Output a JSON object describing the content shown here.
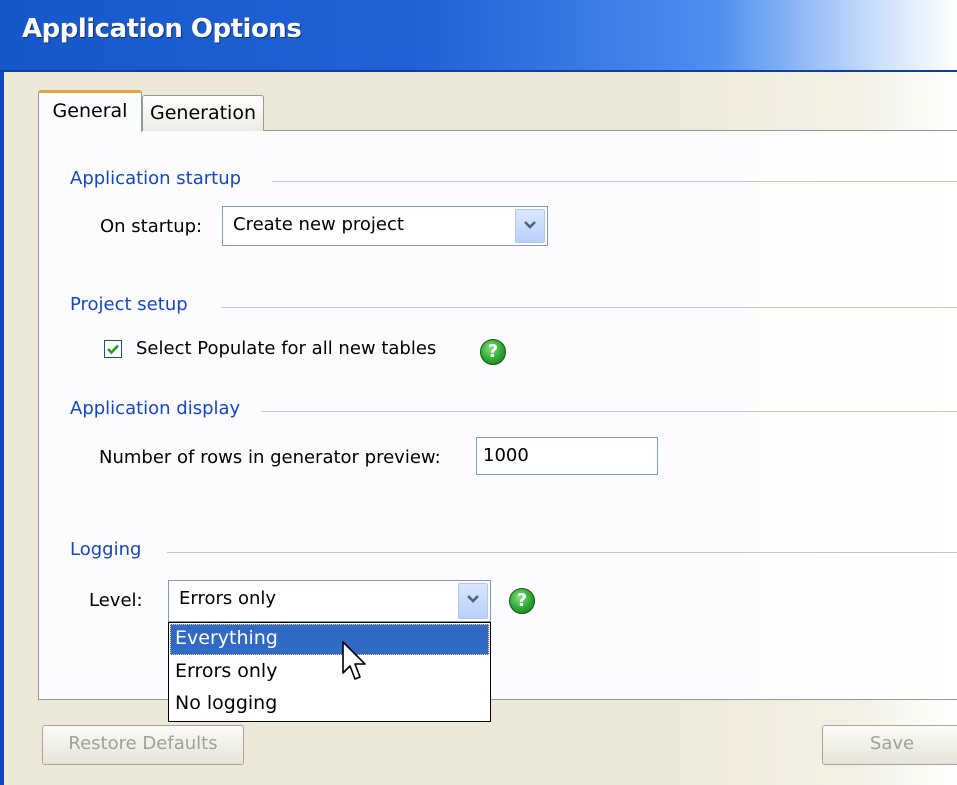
{
  "window": {
    "title": "Application Options"
  },
  "tabs": [
    {
      "label": "General",
      "selected": true
    },
    {
      "label": "Generation",
      "selected": false
    }
  ],
  "sections": {
    "startup": {
      "title": "Application startup",
      "on_startup_label": "On startup:",
      "on_startup_value": "Create new project"
    },
    "project": {
      "title": "Project setup",
      "populate_label": "Select Populate for all new tables",
      "populate_checked": true
    },
    "display": {
      "title": "Application display",
      "rows_label": "Number of rows in generator preview:",
      "rows_value": "1000"
    },
    "logging": {
      "title": "Logging",
      "level_label": "Level:",
      "level_value": "Errors only",
      "options": [
        "Everything",
        "Errors only",
        "No logging"
      ],
      "highlighted_option": "Everything"
    }
  },
  "footer": {
    "restore_label": "Restore Defaults",
    "save_label": "Save"
  },
  "icons": {
    "help": "help-icon",
    "dropdown": "chevron-down-icon",
    "cursor": "mouse-pointer-icon"
  },
  "colors": {
    "section_title": "#1546c8",
    "title_bar": "#1658c9",
    "selection": "#316ac5",
    "help_icon": "#2ea42e"
  }
}
